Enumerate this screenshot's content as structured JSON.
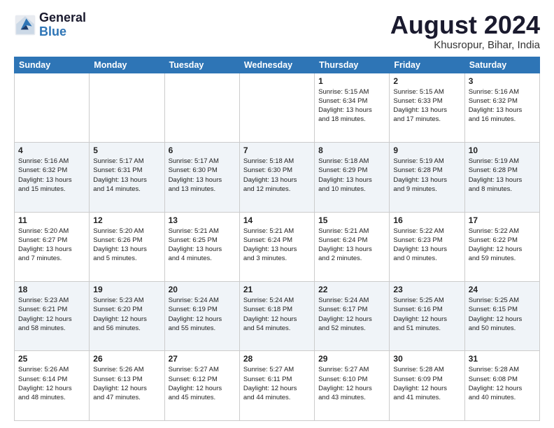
{
  "logo": {
    "line1": "General",
    "line2": "Blue"
  },
  "title": {
    "month_year": "August 2024",
    "location": "Khusropur, Bihar, India"
  },
  "days_of_week": [
    "Sunday",
    "Monday",
    "Tuesday",
    "Wednesday",
    "Thursday",
    "Friday",
    "Saturday"
  ],
  "weeks": [
    [
      {
        "day": "",
        "info": ""
      },
      {
        "day": "",
        "info": ""
      },
      {
        "day": "",
        "info": ""
      },
      {
        "day": "",
        "info": ""
      },
      {
        "day": "1",
        "info": "Sunrise: 5:15 AM\nSunset: 6:34 PM\nDaylight: 13 hours\nand 18 minutes."
      },
      {
        "day": "2",
        "info": "Sunrise: 5:15 AM\nSunset: 6:33 PM\nDaylight: 13 hours\nand 17 minutes."
      },
      {
        "day": "3",
        "info": "Sunrise: 5:16 AM\nSunset: 6:32 PM\nDaylight: 13 hours\nand 16 minutes."
      }
    ],
    [
      {
        "day": "4",
        "info": "Sunrise: 5:16 AM\nSunset: 6:32 PM\nDaylight: 13 hours\nand 15 minutes."
      },
      {
        "day": "5",
        "info": "Sunrise: 5:17 AM\nSunset: 6:31 PM\nDaylight: 13 hours\nand 14 minutes."
      },
      {
        "day": "6",
        "info": "Sunrise: 5:17 AM\nSunset: 6:30 PM\nDaylight: 13 hours\nand 13 minutes."
      },
      {
        "day": "7",
        "info": "Sunrise: 5:18 AM\nSunset: 6:30 PM\nDaylight: 13 hours\nand 12 minutes."
      },
      {
        "day": "8",
        "info": "Sunrise: 5:18 AM\nSunset: 6:29 PM\nDaylight: 13 hours\nand 10 minutes."
      },
      {
        "day": "9",
        "info": "Sunrise: 5:19 AM\nSunset: 6:28 PM\nDaylight: 13 hours\nand 9 minutes."
      },
      {
        "day": "10",
        "info": "Sunrise: 5:19 AM\nSunset: 6:28 PM\nDaylight: 13 hours\nand 8 minutes."
      }
    ],
    [
      {
        "day": "11",
        "info": "Sunrise: 5:20 AM\nSunset: 6:27 PM\nDaylight: 13 hours\nand 7 minutes."
      },
      {
        "day": "12",
        "info": "Sunrise: 5:20 AM\nSunset: 6:26 PM\nDaylight: 13 hours\nand 5 minutes."
      },
      {
        "day": "13",
        "info": "Sunrise: 5:21 AM\nSunset: 6:25 PM\nDaylight: 13 hours\nand 4 minutes."
      },
      {
        "day": "14",
        "info": "Sunrise: 5:21 AM\nSunset: 6:24 PM\nDaylight: 13 hours\nand 3 minutes."
      },
      {
        "day": "15",
        "info": "Sunrise: 5:21 AM\nSunset: 6:24 PM\nDaylight: 13 hours\nand 2 minutes."
      },
      {
        "day": "16",
        "info": "Sunrise: 5:22 AM\nSunset: 6:23 PM\nDaylight: 13 hours\nand 0 minutes."
      },
      {
        "day": "17",
        "info": "Sunrise: 5:22 AM\nSunset: 6:22 PM\nDaylight: 12 hours\nand 59 minutes."
      }
    ],
    [
      {
        "day": "18",
        "info": "Sunrise: 5:23 AM\nSunset: 6:21 PM\nDaylight: 12 hours\nand 58 minutes."
      },
      {
        "day": "19",
        "info": "Sunrise: 5:23 AM\nSunset: 6:20 PM\nDaylight: 12 hours\nand 56 minutes."
      },
      {
        "day": "20",
        "info": "Sunrise: 5:24 AM\nSunset: 6:19 PM\nDaylight: 12 hours\nand 55 minutes."
      },
      {
        "day": "21",
        "info": "Sunrise: 5:24 AM\nSunset: 6:18 PM\nDaylight: 12 hours\nand 54 minutes."
      },
      {
        "day": "22",
        "info": "Sunrise: 5:24 AM\nSunset: 6:17 PM\nDaylight: 12 hours\nand 52 minutes."
      },
      {
        "day": "23",
        "info": "Sunrise: 5:25 AM\nSunset: 6:16 PM\nDaylight: 12 hours\nand 51 minutes."
      },
      {
        "day": "24",
        "info": "Sunrise: 5:25 AM\nSunset: 6:15 PM\nDaylight: 12 hours\nand 50 minutes."
      }
    ],
    [
      {
        "day": "25",
        "info": "Sunrise: 5:26 AM\nSunset: 6:14 PM\nDaylight: 12 hours\nand 48 minutes."
      },
      {
        "day": "26",
        "info": "Sunrise: 5:26 AM\nSunset: 6:13 PM\nDaylight: 12 hours\nand 47 minutes."
      },
      {
        "day": "27",
        "info": "Sunrise: 5:27 AM\nSunset: 6:12 PM\nDaylight: 12 hours\nand 45 minutes."
      },
      {
        "day": "28",
        "info": "Sunrise: 5:27 AM\nSunset: 6:11 PM\nDaylight: 12 hours\nand 44 minutes."
      },
      {
        "day": "29",
        "info": "Sunrise: 5:27 AM\nSunset: 6:10 PM\nDaylight: 12 hours\nand 43 minutes."
      },
      {
        "day": "30",
        "info": "Sunrise: 5:28 AM\nSunset: 6:09 PM\nDaylight: 12 hours\nand 41 minutes."
      },
      {
        "day": "31",
        "info": "Sunrise: 5:28 AM\nSunset: 6:08 PM\nDaylight: 12 hours\nand 40 minutes."
      }
    ]
  ]
}
